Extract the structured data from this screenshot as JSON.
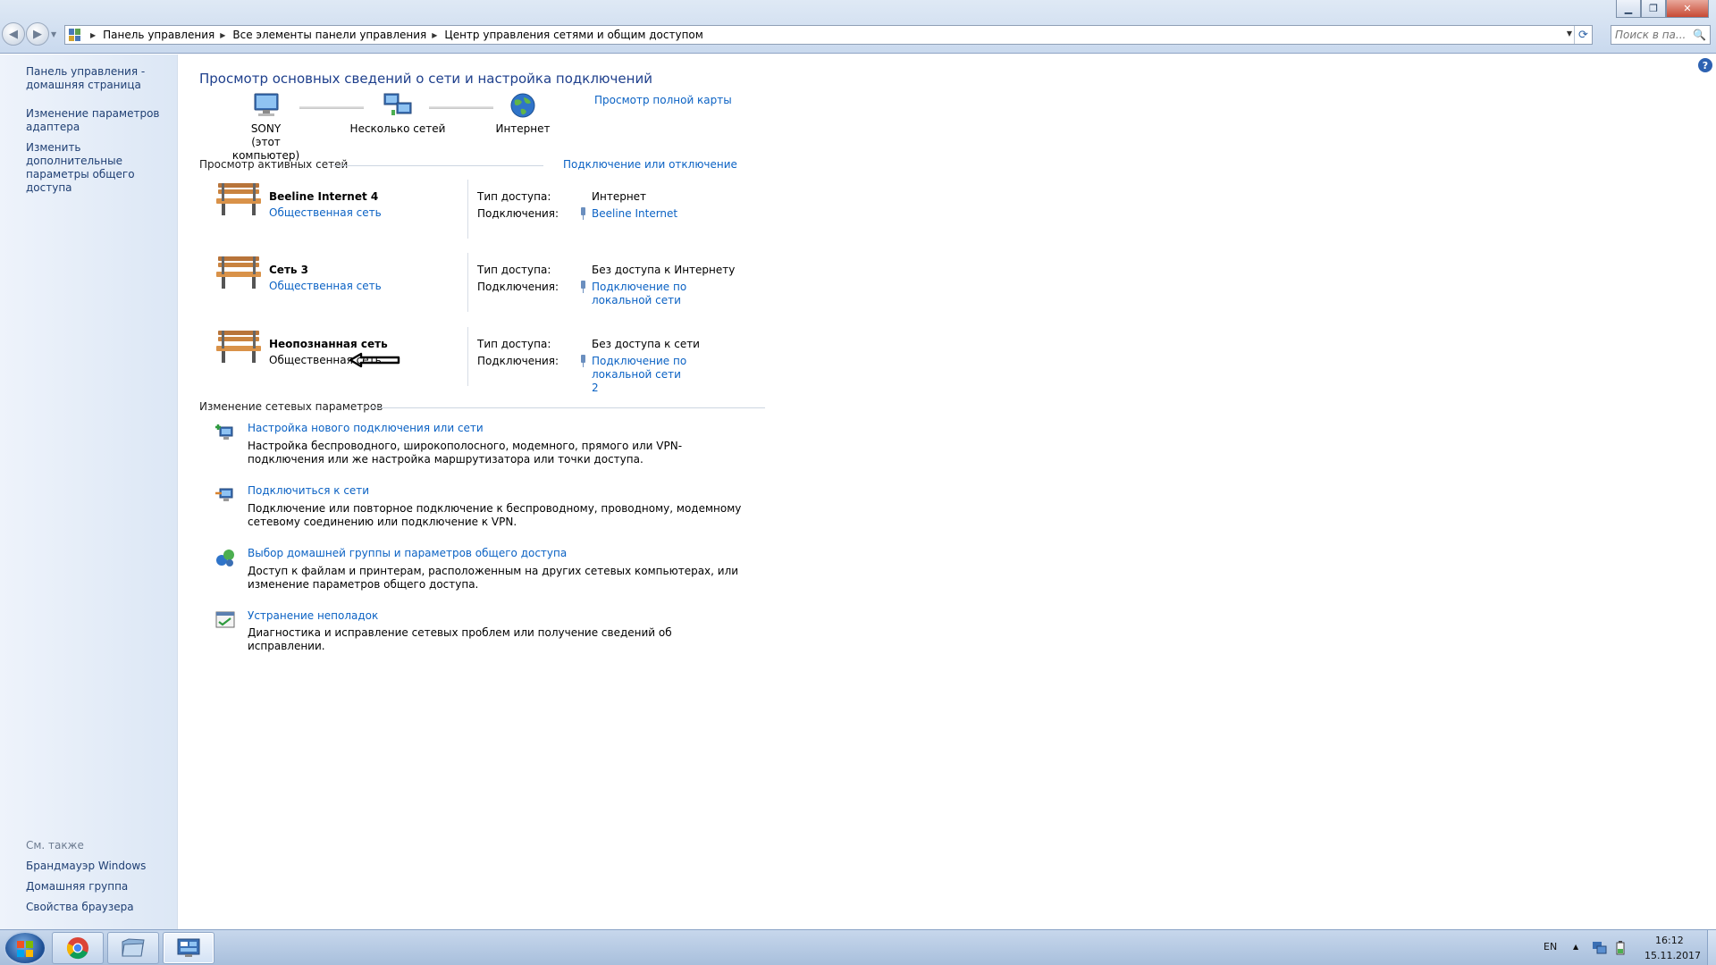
{
  "window": {
    "minimize": "▁",
    "maximize": "❐",
    "close": "✕"
  },
  "nav": {
    "back": "◀",
    "forward": "▶",
    "dropdown": "▼"
  },
  "address": {
    "sep": "▶",
    "crumbs": [
      "Панель управления",
      "Все элементы панели управления",
      "Центр управления сетями и общим доступом"
    ],
    "dropdown": "▼",
    "refresh": "⟳"
  },
  "search": {
    "placeholder": "Поиск в па...",
    "icon": "🔍"
  },
  "left_pane": {
    "home": "Панель управления - домашняя страница",
    "links": [
      "Изменение параметров адаптера",
      "Изменить дополнительные параметры общего доступа"
    ],
    "see_also_title": "См. также",
    "see_also": [
      "Брандмауэр Windows",
      "Домашняя группа",
      "Свойства браузера"
    ]
  },
  "main": {
    "help": "?",
    "title": "Просмотр основных сведений о сети и настройка подключений",
    "full_map_link": "Просмотр полной карты",
    "map": {
      "computer_name": "SONY",
      "computer_sub": "(этот компьютер)",
      "multiple_networks": "Несколько сетей",
      "internet": "Интернет"
    },
    "active_networks_header": "Просмотр активных сетей",
    "connect_disconnect_link": "Подключение или отключение",
    "networks": [
      {
        "name": "Beeline Internet  4",
        "type": "Общественная сеть",
        "access_label": "Тип доступа:",
        "access_value": "Интернет",
        "connections_label": "Подключения:",
        "connection": "Beeline Internet"
      },
      {
        "name": "Сеть  3",
        "type": "Общественная сеть",
        "access_label": "Тип доступа:",
        "access_value": "Без доступа к Интернету",
        "connections_label": "Подключения:",
        "connection": "Подключение по локальной сети"
      },
      {
        "name": "Неопознанная сеть",
        "type": "Общественная сеть",
        "access_label": "Тип доступа:",
        "access_value": "Без доступа к сети",
        "connections_label": "Подключения:",
        "connection": "Подключение по локальной сети 2"
      }
    ],
    "change_settings_header": "Изменение сетевых параметров",
    "tasks": [
      {
        "title": "Настройка нового подключения или сети",
        "desc": "Настройка беспроводного, широкополосного, модемного, прямого или VPN-подключения или же настройка маршрутизатора или точки доступа."
      },
      {
        "title": "Подключиться к сети",
        "desc": "Подключение или повторное подключение к беспроводному, проводному, модемному сетевому соединению или подключение к VPN."
      },
      {
        "title": "Выбор домашней группы и параметров общего доступа",
        "desc": "Доступ к файлам и принтерам, расположенным на других сетевых компьютерах, или изменение параметров общего доступа."
      },
      {
        "title": "Устранение неполадок",
        "desc": "Диагностика и исправление сетевых проблем или получение сведений об исправлении."
      }
    ]
  },
  "taskbar": {
    "language": "EN",
    "tray_arrow": "▲",
    "time": "16:12",
    "date": "15.11.2017"
  }
}
